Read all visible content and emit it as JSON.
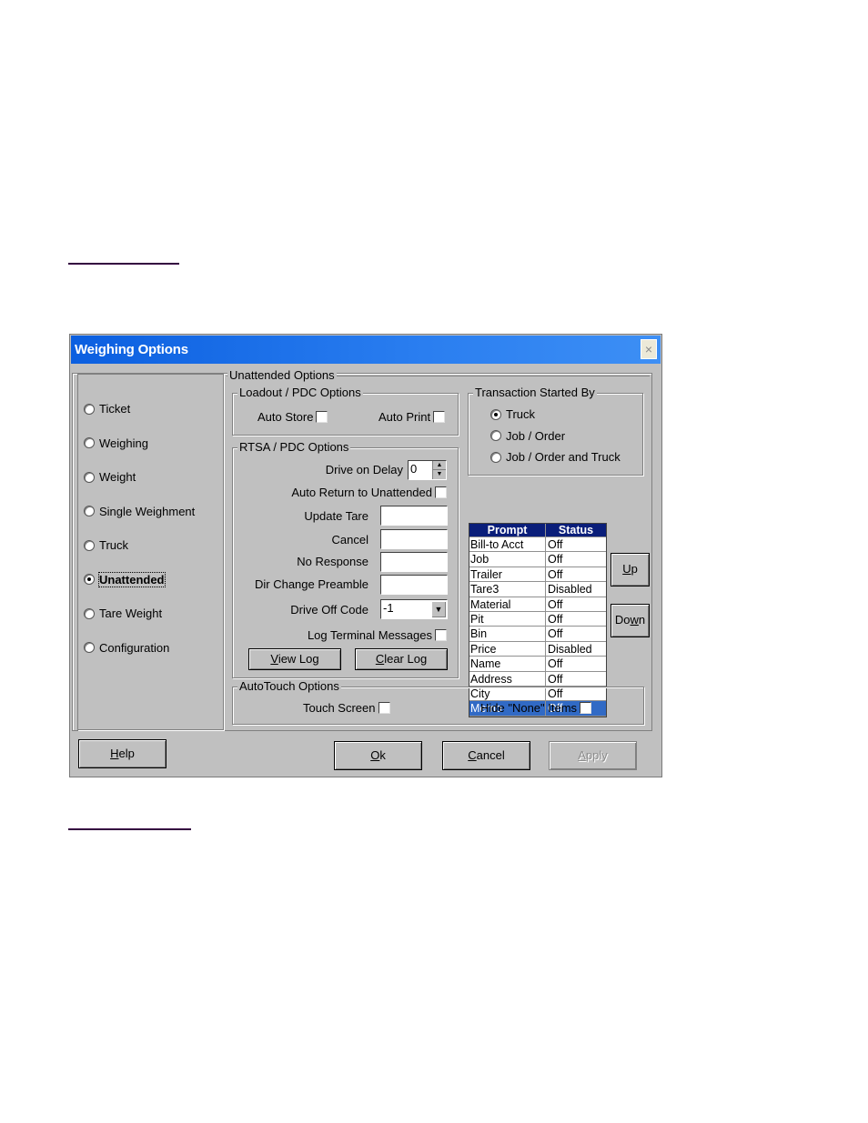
{
  "page": {
    "links": [
      "",
      ""
    ]
  },
  "dialog": {
    "title": "Weighing Options",
    "close_label": "×",
    "categories": [
      {
        "label": "Ticket",
        "selected": false
      },
      {
        "label": "Weighing",
        "selected": false
      },
      {
        "label": "Weight",
        "selected": false
      },
      {
        "label": "Single Weighment",
        "selected": false
      },
      {
        "label": "Truck",
        "selected": false
      },
      {
        "label": "Unattended",
        "selected": true
      },
      {
        "label": "Tare Weight",
        "selected": false
      },
      {
        "label": "Configuration",
        "selected": false
      }
    ],
    "unattended": {
      "title": "Unattended Options",
      "loadout": {
        "title": "Loadout / PDC Options",
        "auto_store_label": "Auto Store",
        "auto_store_checked": false,
        "auto_print_label": "Auto Print",
        "auto_print_checked": false
      },
      "rtsa": {
        "title": "RTSA / PDC Options",
        "drive_on_delay_label": "Drive on Delay",
        "drive_on_delay_value": "0",
        "auto_return_label": "Auto Return to Unattended",
        "auto_return_checked": false,
        "update_tare_label": "Update Tare",
        "update_tare_value": "",
        "cancel_label": "Cancel",
        "cancel_value": "",
        "no_response_label": "No Response",
        "no_response_value": "",
        "dir_change_label": "Dir Change Preamble",
        "dir_change_value": "",
        "drive_off_code_label": "Drive Off Code",
        "drive_off_code_value": "-1",
        "log_terminal_label": "Log Terminal Messages",
        "log_terminal_checked": false,
        "view_log_label": "View Log",
        "view_log_mnemonic": "V",
        "view_log_rest": "iew Log",
        "clear_log_mnemonic": "C",
        "clear_log_rest": "lear Log"
      },
      "transaction": {
        "title": "Transaction Started By",
        "options": [
          {
            "label": "Truck",
            "selected": true
          },
          {
            "label": "Job / Order",
            "selected": false
          },
          {
            "label": "Job / Order and Truck",
            "selected": false
          }
        ]
      },
      "prompt_grid": {
        "columns": [
          "Prompt",
          "Status"
        ],
        "rows": [
          {
            "prompt": "Bill-to Acct",
            "status": "Off"
          },
          {
            "prompt": "Job",
            "status": "Off"
          },
          {
            "prompt": "Trailer",
            "status": "Off"
          },
          {
            "prompt": "Tare3",
            "status": "Disabled"
          },
          {
            "prompt": "Material",
            "status": "Off"
          },
          {
            "prompt": "Pit",
            "status": "Off"
          },
          {
            "prompt": "Bin",
            "status": "Off"
          },
          {
            "prompt": "Price",
            "status": "Disabled"
          },
          {
            "prompt": "Name",
            "status": "Off"
          },
          {
            "prompt": "Address",
            "status": "Off"
          },
          {
            "prompt": "City",
            "status": "Off"
          },
          {
            "prompt": "Memo",
            "status": "Off",
            "selected": true
          }
        ],
        "up_mnemonic": "U",
        "up_rest": "p",
        "down_pre": "Do",
        "down_mnemonic": "w",
        "down_rest": "n"
      },
      "autotouch": {
        "title": "AutoTouch Options",
        "touch_screen_label": "Touch Screen",
        "touch_screen_checked": false,
        "hide_none_label": "Hide \"None\" Items",
        "hide_none_checked": false
      }
    },
    "buttons": {
      "help_mnemonic": "H",
      "help_rest": "elp",
      "ok_mnemonic": "O",
      "ok_rest": "k",
      "cancel_mnemonic": "C",
      "cancel_rest": "ancel",
      "apply_mnemonic": "A",
      "apply_rest": "pply",
      "apply_enabled": false
    }
  }
}
